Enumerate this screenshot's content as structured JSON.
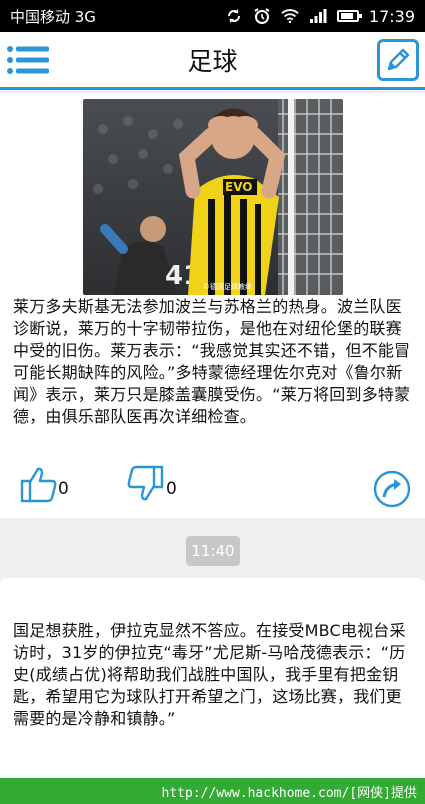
{
  "status_bar": {
    "carrier": "中国移动 3G",
    "time": "17:39"
  },
  "header": {
    "title": "足球"
  },
  "article1": {
    "image_caption": "©德国足球教练",
    "jersey_text": "EVO",
    "player_number": "41",
    "text": "莱万多夫斯基无法参加波兰与苏格兰的热身。波兰队医诊断说，莱万的十字韧带拉伤，是他在对纽伦堡的联赛中受的旧伤。莱万表示：“我感觉其实还不错，但不能冒可能长期缺阵的风险。”多特蒙德经理佐尔克对《鲁尔新闻》表示，莱万只是膝盖囊膜受伤。“莱万将回到多特蒙德，由俱乐部队医再次详细检查。",
    "likes": "0",
    "dislikes": "0"
  },
  "separator": {
    "time": "11:40"
  },
  "article2": {
    "text": "国足想获胜，伊拉克显然不答应。在接受MBC电视台采访时，31岁的伊拉克“毒牙”尤尼斯-马哈茂德表示：“历史(成绩占优)将帮助我们战胜中国队，我手里有把金钥匙，希望用它为球队打开希望之门，这场比赛，我们更需要的是冷静和镇静。”"
  },
  "watermark": "http://www.hackhome.com/[网侠]提供",
  "colors": {
    "accent": "#2b95d6",
    "footer": "#33aa33",
    "jersey_yellow": "#f0d218"
  }
}
